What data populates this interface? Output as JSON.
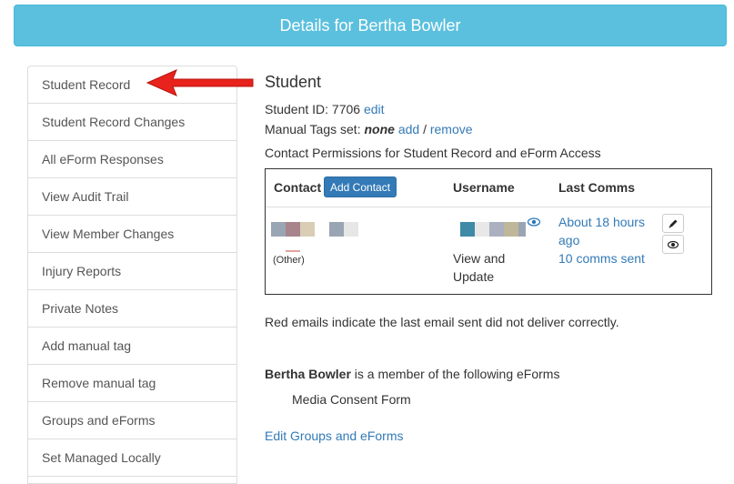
{
  "header": {
    "title": "Details for Bertha Bowler"
  },
  "sidebar": {
    "items": [
      {
        "label": "Student Record"
      },
      {
        "label": "Student Record Changes"
      },
      {
        "label": "All eForm Responses"
      },
      {
        "label": "View Audit Trail"
      },
      {
        "label": "View Member Changes"
      },
      {
        "label": "Injury Reports"
      },
      {
        "label": "Private Notes"
      },
      {
        "label": "Add manual tag"
      },
      {
        "label": "Remove manual tag"
      },
      {
        "label": "Groups and eForms"
      },
      {
        "label": "Set Managed Locally"
      }
    ]
  },
  "main": {
    "heading": "Student",
    "student_id_label": "Student ID: 7706",
    "edit_link": "edit",
    "tags_label": "Manual Tags set:",
    "tags_value": "none",
    "tags_add": "add",
    "tags_sep": "/",
    "tags_remove": "remove",
    "permissions_text": "Contact Permissions for Student Record and eForm Access",
    "table": {
      "col_contact": "Contact",
      "add_contact_button": "Add Contact",
      "col_username": "Username",
      "col_last_comms": "Last Comms",
      "row": {
        "relation": "(Other)",
        "access_line1": "View and",
        "access_line2": "Update",
        "last_comms_line1": "About 18 hours",
        "last_comms_line2": "ago",
        "comms_sent": "10 comms sent"
      }
    },
    "red_emails_note": "Red emails indicate the last email sent did not deliver correctly.",
    "member_name": "Bertha Bowler",
    "member_text": " is a member of the following eForms",
    "eforms": [
      "Media Consent Form"
    ],
    "edit_groups_link": "Edit Groups and eForms"
  },
  "icons": {
    "pencil": "pencil-icon",
    "eye": "eye-icon",
    "arrow": "red-arrow-icon"
  },
  "colors": {
    "banner": "#5bc0de",
    "link": "#337ab7",
    "button": "#337ab7",
    "arrow": "#e8221c"
  }
}
